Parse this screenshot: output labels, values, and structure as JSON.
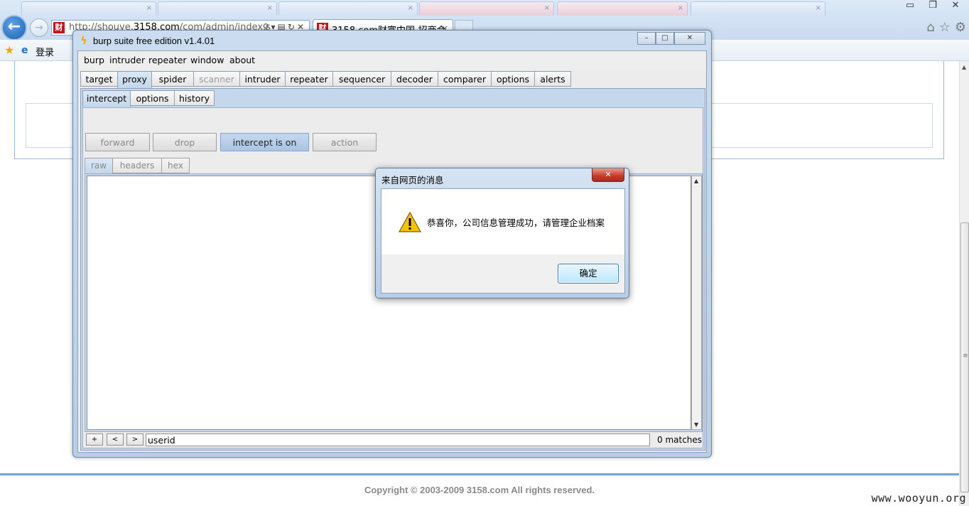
{
  "browser": {
    "address_prefix": "http://shouye.",
    "address_domain": "3158.com",
    "address_path": "/com/admin/index.s",
    "page_tab_title": "3158.com财富中国-招商会",
    "page_tab_favicon": "财",
    "favorites_login": "登录",
    "window_controls": [
      "▭",
      "❐",
      "✕"
    ]
  },
  "burp": {
    "title": "burp suite free edition v1.4.01",
    "menu": [
      "burp",
      "intruder",
      "repeater",
      "window",
      "about"
    ],
    "tabs": [
      {
        "label": "target",
        "state": "normal"
      },
      {
        "label": "proxy",
        "state": "selected"
      },
      {
        "label": "spider",
        "state": "normal"
      },
      {
        "label": "scanner",
        "state": "disabled"
      },
      {
        "label": "intruder",
        "state": "normal"
      },
      {
        "label": "repeater",
        "state": "normal"
      },
      {
        "label": "sequencer",
        "state": "normal"
      },
      {
        "label": "decoder",
        "state": "normal"
      },
      {
        "label": "comparer",
        "state": "normal"
      },
      {
        "label": "options",
        "state": "normal"
      },
      {
        "label": "alerts",
        "state": "normal"
      }
    ],
    "proxy_tabs": [
      "intercept",
      "options",
      "history"
    ],
    "buttons": {
      "forward": "forward",
      "drop": "drop",
      "intercept": "intercept is on",
      "action": "action"
    },
    "message_tabs": [
      "raw",
      "headers",
      "hex"
    ],
    "search": {
      "plus": "+",
      "prev": "<",
      "next": ">",
      "value": "userid",
      "matches": "0 matches"
    }
  },
  "dialog": {
    "title": "来自网页的消息",
    "message": "恭喜你，公司信息管理成功，请管理企业档案",
    "ok_label": "确定",
    "icon": "warning-icon"
  },
  "webpage": {
    "copyright": "Copyright © 2003-2009 3158.com All rights reserved."
  },
  "watermark": "www.wooyun.org"
}
